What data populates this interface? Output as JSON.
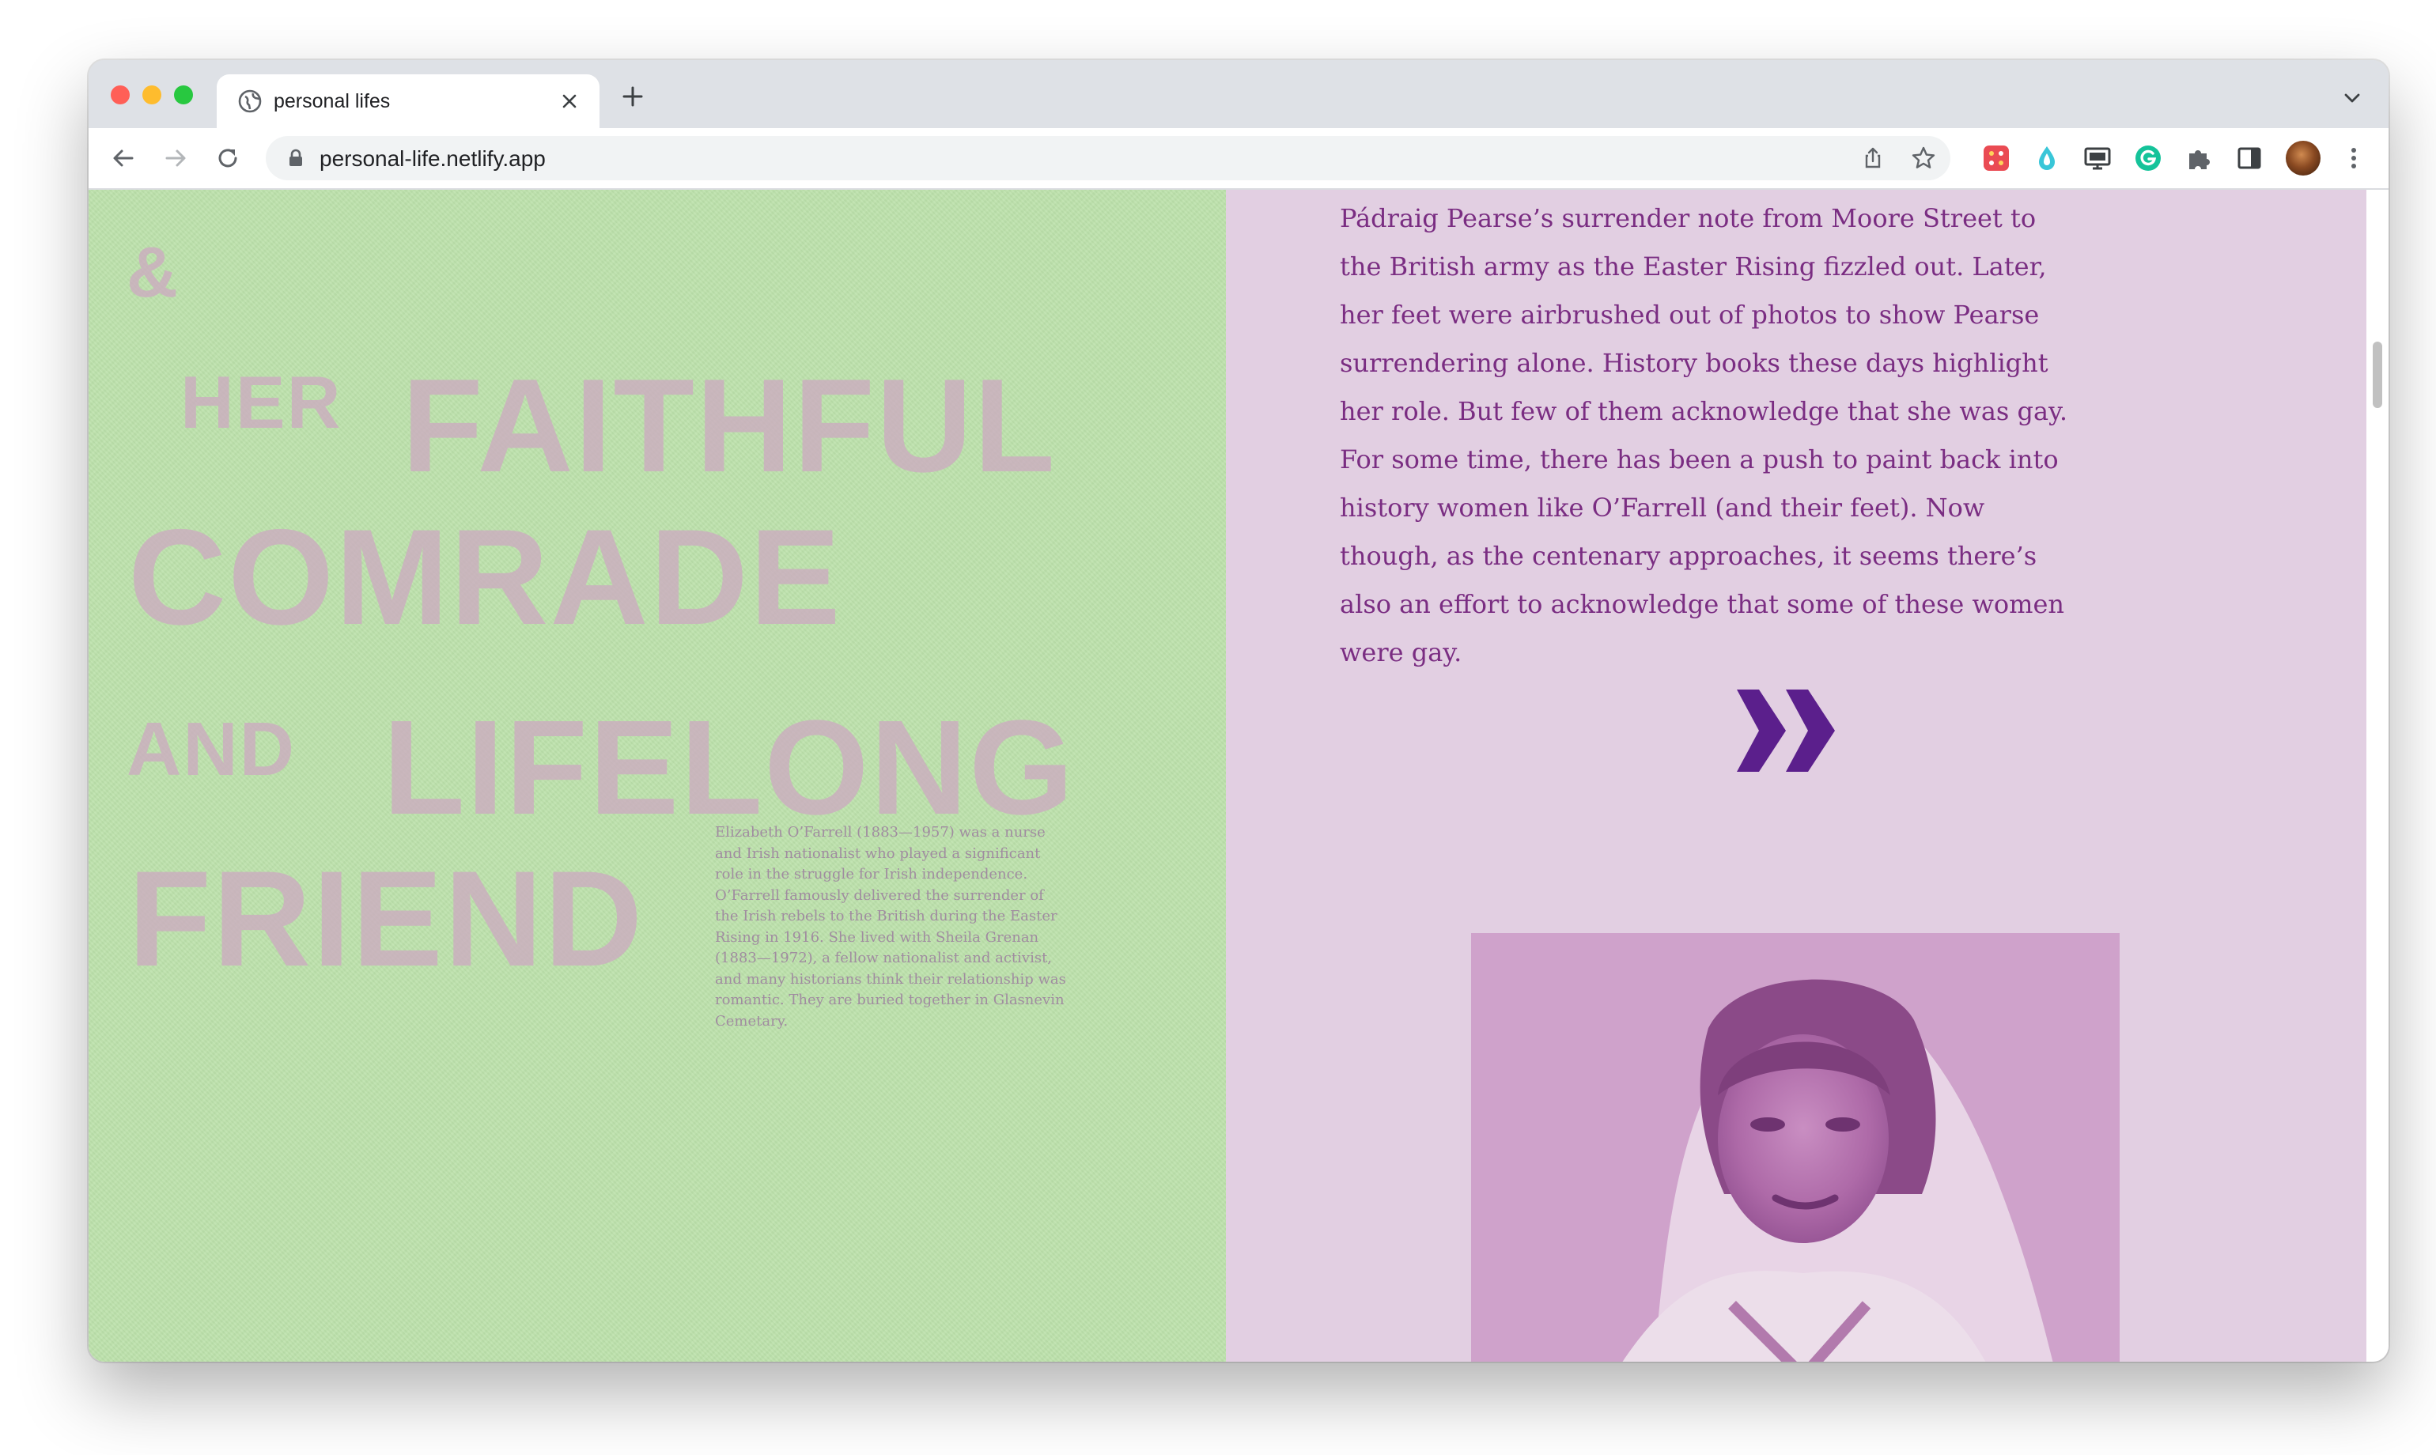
{
  "browser": {
    "tab_title": "personal lifes",
    "url": "personal-life.netlify.app"
  },
  "poster": {
    "words": [
      "&",
      "HER",
      "FAITHFUL",
      "COMRADE",
      "AND",
      "LIFELONG",
      "FRIEND"
    ],
    "bio": "Elizabeth O’Farrell (1883—1957) was a nurse and Irish nationalist who played a significant role in the struggle for Irish independence. O’Farrell famously delivered the surrender of the Irish rebels to the British during the Easter Rising in 1916. She lived with Sheila Grenan (1883—1972), a fellow nationalist and activist, and many historians think their relationship was romantic. They are buried together in Glasnevin Cemetary."
  },
  "article": {
    "paragraph": "Pádraig Pearse’s surrender note from Moore Street to the British army as the Easter Rising fizzled out. Later, her feet were airbrushed out of photos to show Pearse surrendering alone. History books these days highlight her role. But few of them acknowledge that she was gay. For some time, there has been a push to paint back into history women like O’Farrell (and their feet). Now though, as the centenary approaches, it seems there’s also an effort to acknowledge that some of these women were gay."
  },
  "icons": {
    "tab_favicon": "globe-icon",
    "tab_close": "close-icon",
    "new_tab": "plus-icon",
    "tab_search": "chevron-down-icon",
    "back": "arrow-left-icon",
    "forward": "arrow-right-icon",
    "reload": "reload-icon",
    "lock": "lock-icon",
    "share": "share-icon",
    "bookmark": "star-icon",
    "menu": "kebab-menu-icon",
    "next_section": "double-chevron-right-icon"
  },
  "colors": {
    "poster_background": "#bde2ac",
    "poster_lettering": "#ccaac0",
    "article_background": "#e2cfe2",
    "article_text": "#7a2d82",
    "chevron": "#5b1f8c"
  }
}
